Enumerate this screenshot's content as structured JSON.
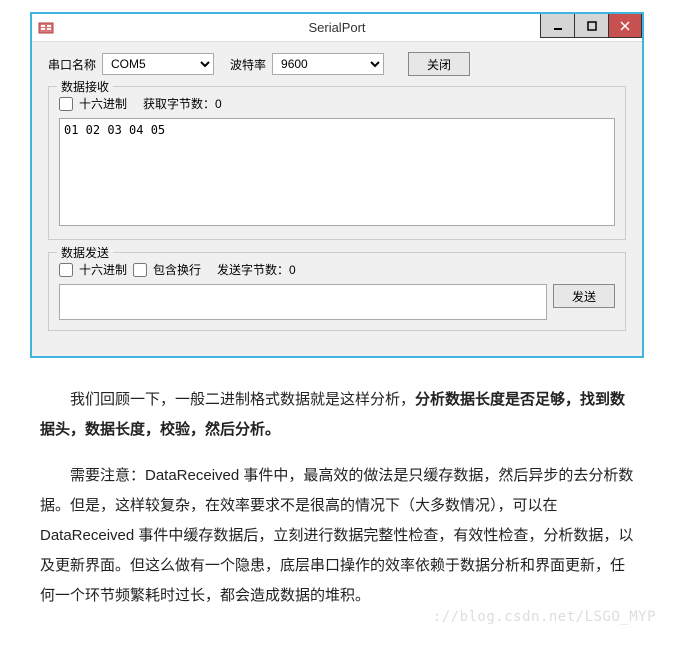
{
  "window": {
    "title": "SerialPort"
  },
  "topRow": {
    "portLabel": "串口名称",
    "portValue": "COM5",
    "baudLabel": "波特率",
    "baudValue": "9600",
    "closeBtn": "关闭"
  },
  "recv": {
    "groupTitle": "数据接收",
    "hexLabel": "十六进制",
    "bytesLabel": "获取字节数：0",
    "text": "01 02 03 04 05"
  },
  "send": {
    "groupTitle": "数据发送",
    "hexLabel": "十六进制",
    "newlineLabel": "包含换行",
    "bytesLabel": "发送字节数：0",
    "text": "",
    "sendBtn": "发送"
  },
  "article": {
    "p1a": "我们回顾一下，一般二进制格式数据就是这样分析，",
    "p1b": "分析数据长度是否足够，找到数据头，数据长度，校验，然后分析。",
    "p2": "需要注意：DataReceived 事件中，最高效的做法是只缓存数据，然后异步的去分析数据。但是，这样较复杂，在效率要求不是很高的情况下（大多数情况），可以在 DataReceived 事件中缓存数据后，立刻进行数据完整性检查，有效性检查，分析数据，以及更新界面。但这么做有一个隐患，底层串口操作的效率依赖于数据分析和界面更新，任何一个环节频繁耗时过长，都会造成数据的堆积。"
  },
  "watermark": "://blog.csdn.net/LSGO_MYP"
}
